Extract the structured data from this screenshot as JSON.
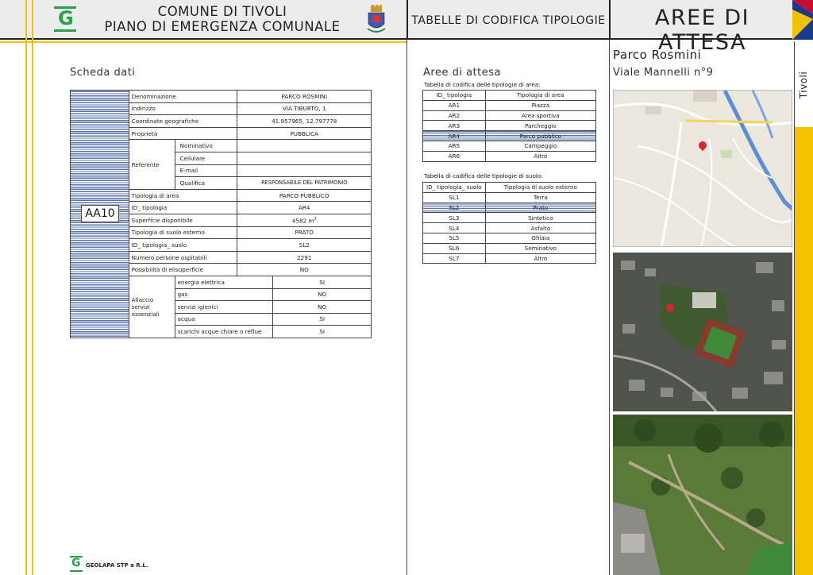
{
  "header": {
    "municipality_line1": "COMUNE DI TIVOLI",
    "municipality_line2": "PIANO DI EMERGENZA COMUNALE",
    "center_title": "TABELLE DI CODIFICA TIPOLOGIE",
    "right_title": "AREE DI ATTESA",
    "logo_letter": "G"
  },
  "left": {
    "section_title": "Scheda dati",
    "area_code": "AA10",
    "rows": {
      "denominazione": {
        "label": "Denominazione",
        "value": "PARCO ROSMINI"
      },
      "indirizzo": {
        "label": "Indirizzo",
        "value": "VIA TIBURTO, 1"
      },
      "coordinate": {
        "label": "Coordinate geografiche",
        "value": "41.957965, 12.797778"
      },
      "proprieta": {
        "label": "Proprietà",
        "value": "PUBBLICA"
      },
      "referente": {
        "label": "Referente",
        "nominativo": {
          "label": "Nominativo",
          "value": ""
        },
        "cellulare": {
          "label": "Cellulare",
          "value": ""
        },
        "email": {
          "label": "E-mail",
          "value": ""
        },
        "qualifica": {
          "label": "Qualifica",
          "value": "RESPONSABILE DEL PATRIMONIO"
        }
      },
      "tipologia_area": {
        "label": "Tipologia di area",
        "value": "PARCO PUBBLICO"
      },
      "id_tipologia": {
        "label": "ID_ tipologia",
        "value": "AR4"
      },
      "superficie": {
        "label": "Superficie disponibile",
        "value": "4582 m",
        "unit_sup": "2"
      },
      "tipologia_suolo": {
        "label": "Tipologia di suolo esterno",
        "value": "PRATO"
      },
      "id_tipologia_suolo": {
        "label": "ID_ tipologia_ suolo",
        "value": "SL2"
      },
      "persone": {
        "label": "Numero persone ospitabili",
        "value": "2291"
      },
      "elisuperficie": {
        "label": "Possibilità di elisuperficie",
        "value": "NO"
      },
      "allaccio": {
        "label": "Allaccio servizi essenziali",
        "energia": {
          "label": "energia elettrica",
          "value": "SI"
        },
        "gas": {
          "label": "gas",
          "value": "NO"
        },
        "igienici": {
          "label": "servizi igienici",
          "value": "NO"
        },
        "acqua": {
          "label": "acqua",
          "value": "SI"
        },
        "scarichi": {
          "label": "scarichi acque chiare o reflue",
          "value": "SI"
        }
      }
    },
    "footer_brand": "GEOLAPA STP  a R.L."
  },
  "middle": {
    "section_title": "Aree di attesa",
    "area_table_caption": "Tabella di codifica delle tipologie di area:",
    "area_table_headers": [
      "ID_ tipologia",
      "Tipologia di area"
    ],
    "area_rows": [
      {
        "id": "AR1",
        "name": "Piazza"
      },
      {
        "id": "AR2",
        "name": "Area sportiva"
      },
      {
        "id": "AR3",
        "name": "Parcheggio"
      },
      {
        "id": "AR4",
        "name": "Parco pubblico"
      },
      {
        "id": "AR5",
        "name": "Campeggio"
      },
      {
        "id": "AR6",
        "name": "Altro"
      }
    ],
    "soil_table_caption": "Tabella di codifica delle tipologie di suolo:",
    "soil_table_headers": [
      "ID_ tipologia_ suolo",
      "Tipologia di suolo esterno"
    ],
    "soil_rows": [
      {
        "id": "SL1",
        "name": "Terra"
      },
      {
        "id": "SL2",
        "name": "Prato"
      },
      {
        "id": "SL3",
        "name": "Sintetico"
      },
      {
        "id": "SL4",
        "name": "Asfalto"
      },
      {
        "id": "SL5",
        "name": "Ghiaia"
      },
      {
        "id": "SL6",
        "name": "Seminativo"
      },
      {
        "id": "SL7",
        "name": "Altro"
      }
    ],
    "selected_area": "AR4",
    "selected_soil": "SL2"
  },
  "right": {
    "place_name": "Parco Rosmini",
    "address": "Viale Mannelli n°9",
    "side_tab": "Tivoli"
  },
  "colors": {
    "accent_yellow": "#f2c200",
    "header_bg": "#ececec",
    "stripe_blue": "#5b74b0",
    "logo_green": "#2aa04a",
    "corner_red": "#c8102e",
    "corner_blue": "#1a3a8f"
  }
}
